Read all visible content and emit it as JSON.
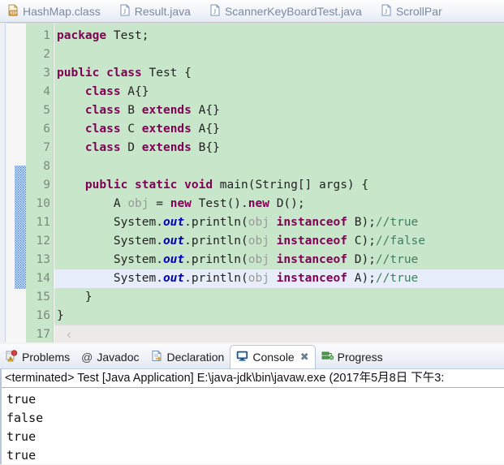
{
  "editor_tabs": [
    {
      "label": "HashMap.class",
      "icon": "class-file-icon",
      "active": false
    },
    {
      "label": "Result.java",
      "icon": "java-file-icon",
      "active": false
    },
    {
      "label": "ScannerKeyBoardTest.java",
      "icon": "java-file-icon",
      "active": false
    },
    {
      "label": "ScrollPar",
      "icon": "java-file-icon",
      "active": false
    }
  ],
  "editor": {
    "line_numbers": [
      "1",
      "2",
      "3",
      "4",
      "5",
      "6",
      "7",
      "8",
      "9",
      "10",
      "11",
      "12",
      "13",
      "14",
      "15",
      "16",
      "17"
    ],
    "current_line": 14,
    "scroll_left_arrow": "‹",
    "code_lines": [
      {
        "n": 1,
        "tokens": [
          {
            "t": "package",
            "c": "kw"
          },
          {
            "t": " Test;",
            "c": "pl"
          }
        ]
      },
      {
        "n": 2,
        "tokens": []
      },
      {
        "n": 3,
        "tokens": [
          {
            "t": "public class",
            "c": "kw"
          },
          {
            "t": " Test {",
            "c": "pl"
          }
        ]
      },
      {
        "n": 4,
        "tokens": [
          {
            "t": "    ",
            "c": "pl"
          },
          {
            "t": "class",
            "c": "kw"
          },
          {
            "t": " A{}",
            "c": "pl"
          }
        ]
      },
      {
        "n": 5,
        "tokens": [
          {
            "t": "    ",
            "c": "pl"
          },
          {
            "t": "class",
            "c": "kw"
          },
          {
            "t": " B ",
            "c": "pl"
          },
          {
            "t": "extends",
            "c": "kw"
          },
          {
            "t": " A{}",
            "c": "pl"
          }
        ]
      },
      {
        "n": 6,
        "tokens": [
          {
            "t": "    ",
            "c": "pl"
          },
          {
            "t": "class",
            "c": "kw"
          },
          {
            "t": " C ",
            "c": "pl"
          },
          {
            "t": "extends",
            "c": "kw"
          },
          {
            "t": " A{}",
            "c": "pl"
          }
        ]
      },
      {
        "n": 7,
        "tokens": [
          {
            "t": "    ",
            "c": "pl"
          },
          {
            "t": "class",
            "c": "kw"
          },
          {
            "t": " D ",
            "c": "pl"
          },
          {
            "t": "extends",
            "c": "kw"
          },
          {
            "t": " B{}",
            "c": "pl"
          }
        ]
      },
      {
        "n": 8,
        "tokens": []
      },
      {
        "n": 9,
        "tokens": [
          {
            "t": "    ",
            "c": "pl"
          },
          {
            "t": "public static void",
            "c": "kw"
          },
          {
            "t": " main(String[] args) {",
            "c": "pl"
          }
        ]
      },
      {
        "n": 10,
        "tokens": [
          {
            "t": "        A ",
            "c": "pl"
          },
          {
            "t": "obj",
            "c": "loc"
          },
          {
            "t": " = ",
            "c": "pl"
          },
          {
            "t": "new",
            "c": "kw"
          },
          {
            "t": " Test().",
            "c": "pl"
          },
          {
            "t": "new",
            "c": "kw"
          },
          {
            "t": " D();",
            "c": "pl"
          }
        ]
      },
      {
        "n": 11,
        "tokens": [
          {
            "t": "        System.",
            "c": "pl"
          },
          {
            "t": "out",
            "c": "var"
          },
          {
            "t": ".println(",
            "c": "pl"
          },
          {
            "t": "obj",
            "c": "loc"
          },
          {
            "t": " ",
            "c": "pl"
          },
          {
            "t": "instanceof",
            "c": "kw"
          },
          {
            "t": " B);",
            "c": "pl"
          },
          {
            "t": "//true",
            "c": "cmt"
          }
        ]
      },
      {
        "n": 12,
        "tokens": [
          {
            "t": "        System.",
            "c": "pl"
          },
          {
            "t": "out",
            "c": "var"
          },
          {
            "t": ".println(",
            "c": "pl"
          },
          {
            "t": "obj",
            "c": "loc"
          },
          {
            "t": " ",
            "c": "pl"
          },
          {
            "t": "instanceof",
            "c": "kw"
          },
          {
            "t": " C);",
            "c": "pl"
          },
          {
            "t": "//false",
            "c": "cmt"
          }
        ]
      },
      {
        "n": 13,
        "tokens": [
          {
            "t": "        System.",
            "c": "pl"
          },
          {
            "t": "out",
            "c": "var"
          },
          {
            "t": ".println(",
            "c": "pl"
          },
          {
            "t": "obj",
            "c": "loc"
          },
          {
            "t": " ",
            "c": "pl"
          },
          {
            "t": "instanceof",
            "c": "kw"
          },
          {
            "t": " D);",
            "c": "pl"
          },
          {
            "t": "//true",
            "c": "cmt"
          }
        ]
      },
      {
        "n": 14,
        "tokens": [
          {
            "t": "        System.",
            "c": "pl"
          },
          {
            "t": "out",
            "c": "var"
          },
          {
            "t": ".println(",
            "c": "pl"
          },
          {
            "t": "obj",
            "c": "loc"
          },
          {
            "t": " ",
            "c": "pl"
          },
          {
            "t": "instanceof",
            "c": "kw"
          },
          {
            "t": " A);",
            "c": "pl"
          },
          {
            "t": "//true",
            "c": "cmt"
          }
        ]
      },
      {
        "n": 15,
        "tokens": [
          {
            "t": "    }",
            "c": "pl"
          }
        ]
      },
      {
        "n": 16,
        "tokens": [
          {
            "t": "}",
            "c": "pl"
          }
        ]
      },
      {
        "n": 17,
        "tokens": []
      }
    ]
  },
  "view_tabs": [
    {
      "label": "Problems",
      "icon": "problems-icon",
      "active": false,
      "closable": false
    },
    {
      "label": "Javadoc",
      "icon": "javadoc-icon",
      "active": false,
      "closable": false
    },
    {
      "label": "Declaration",
      "icon": "declaration-icon",
      "active": false,
      "closable": false
    },
    {
      "label": "Console",
      "icon": "console-icon",
      "active": true,
      "closable": true
    },
    {
      "label": "Progress",
      "icon": "progress-icon",
      "active": false,
      "closable": false
    }
  ],
  "console": {
    "close_glyph": "✖",
    "header": "<terminated> Test [Java Application] E:\\java-jdk\\bin\\javaw.exe (2017年5月8日 下午3:",
    "output": [
      "true",
      "false",
      "true",
      "true"
    ]
  },
  "colors": {
    "editor_background": "#c8e6c9",
    "keyword": "#7f0055",
    "comment": "#3f7f5f",
    "static_field": "#0000c0",
    "local_var": "#9a9a9a",
    "current_line": "#e8eef9",
    "fold_marker": "#3f7fd4"
  }
}
